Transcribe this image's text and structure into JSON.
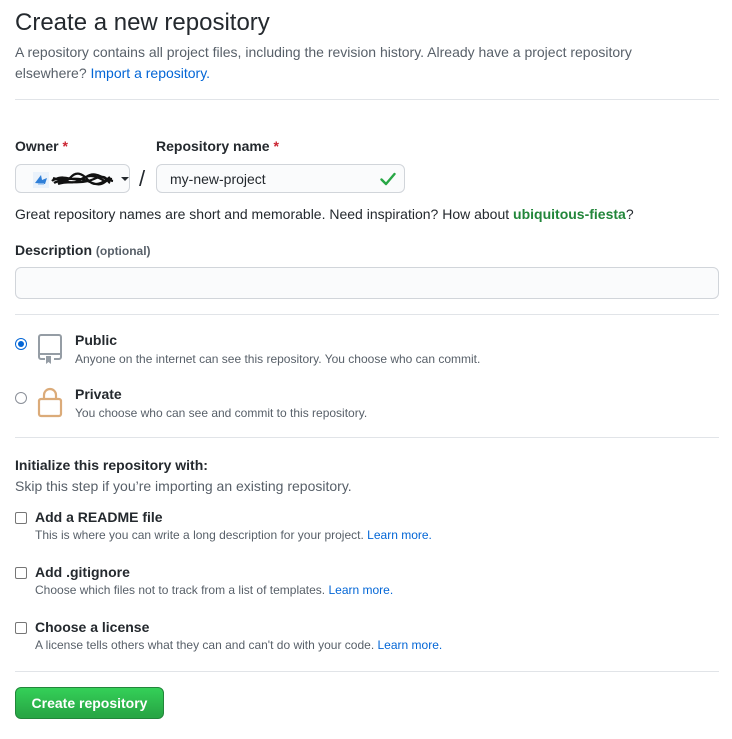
{
  "header": {
    "title": "Create a new repository",
    "subtitle_text": "A repository contains all project files, including the revision history. Already have a project repository elsewhere?",
    "import_link": "Import a repository."
  },
  "owner": {
    "label": "Owner",
    "required_mark": "*"
  },
  "repository_name": {
    "label": "Repository name",
    "required_mark": "*",
    "value": "my-new-project",
    "valid": true
  },
  "separator": "/",
  "hint": {
    "text": "Great repository names are short and memorable. Need inspiration? How about",
    "suggestion": "ubiquitous-fiesta",
    "suffix": "?"
  },
  "description": {
    "label": "Description",
    "optional_label": "(optional)",
    "value": ""
  },
  "visibility": {
    "selected": "public",
    "options": [
      {
        "id": "public",
        "title": "Public",
        "description": "Anyone on the internet can see this repository. You choose who can commit.",
        "icon": "repo-icon"
      },
      {
        "id": "private",
        "title": "Private",
        "description": "You choose who can see and commit to this repository.",
        "icon": "lock-icon"
      }
    ]
  },
  "initialize": {
    "title": "Initialize this repository with:",
    "subtitle": "Skip this step if you’re importing an existing repository.",
    "options": [
      {
        "title": "Add a README file",
        "description": "This is where you can write a long description for your project.",
        "link": "Learn more.",
        "checked": false
      },
      {
        "title": "Add .gitignore",
        "description": "Choose which files not to track from a list of templates.",
        "link": "Learn more.",
        "checked": false
      },
      {
        "title": "Choose a license",
        "description": "A license tells others what they can and can't do with your code.",
        "link": "Learn more.",
        "checked": false
      }
    ]
  },
  "submit": {
    "label": "Create repository"
  },
  "colors": {
    "link": "#0366d6",
    "suggestion": "#22863a",
    "required": "#cb2431",
    "button": "#2ea44f",
    "valid_check": "#28a745"
  }
}
